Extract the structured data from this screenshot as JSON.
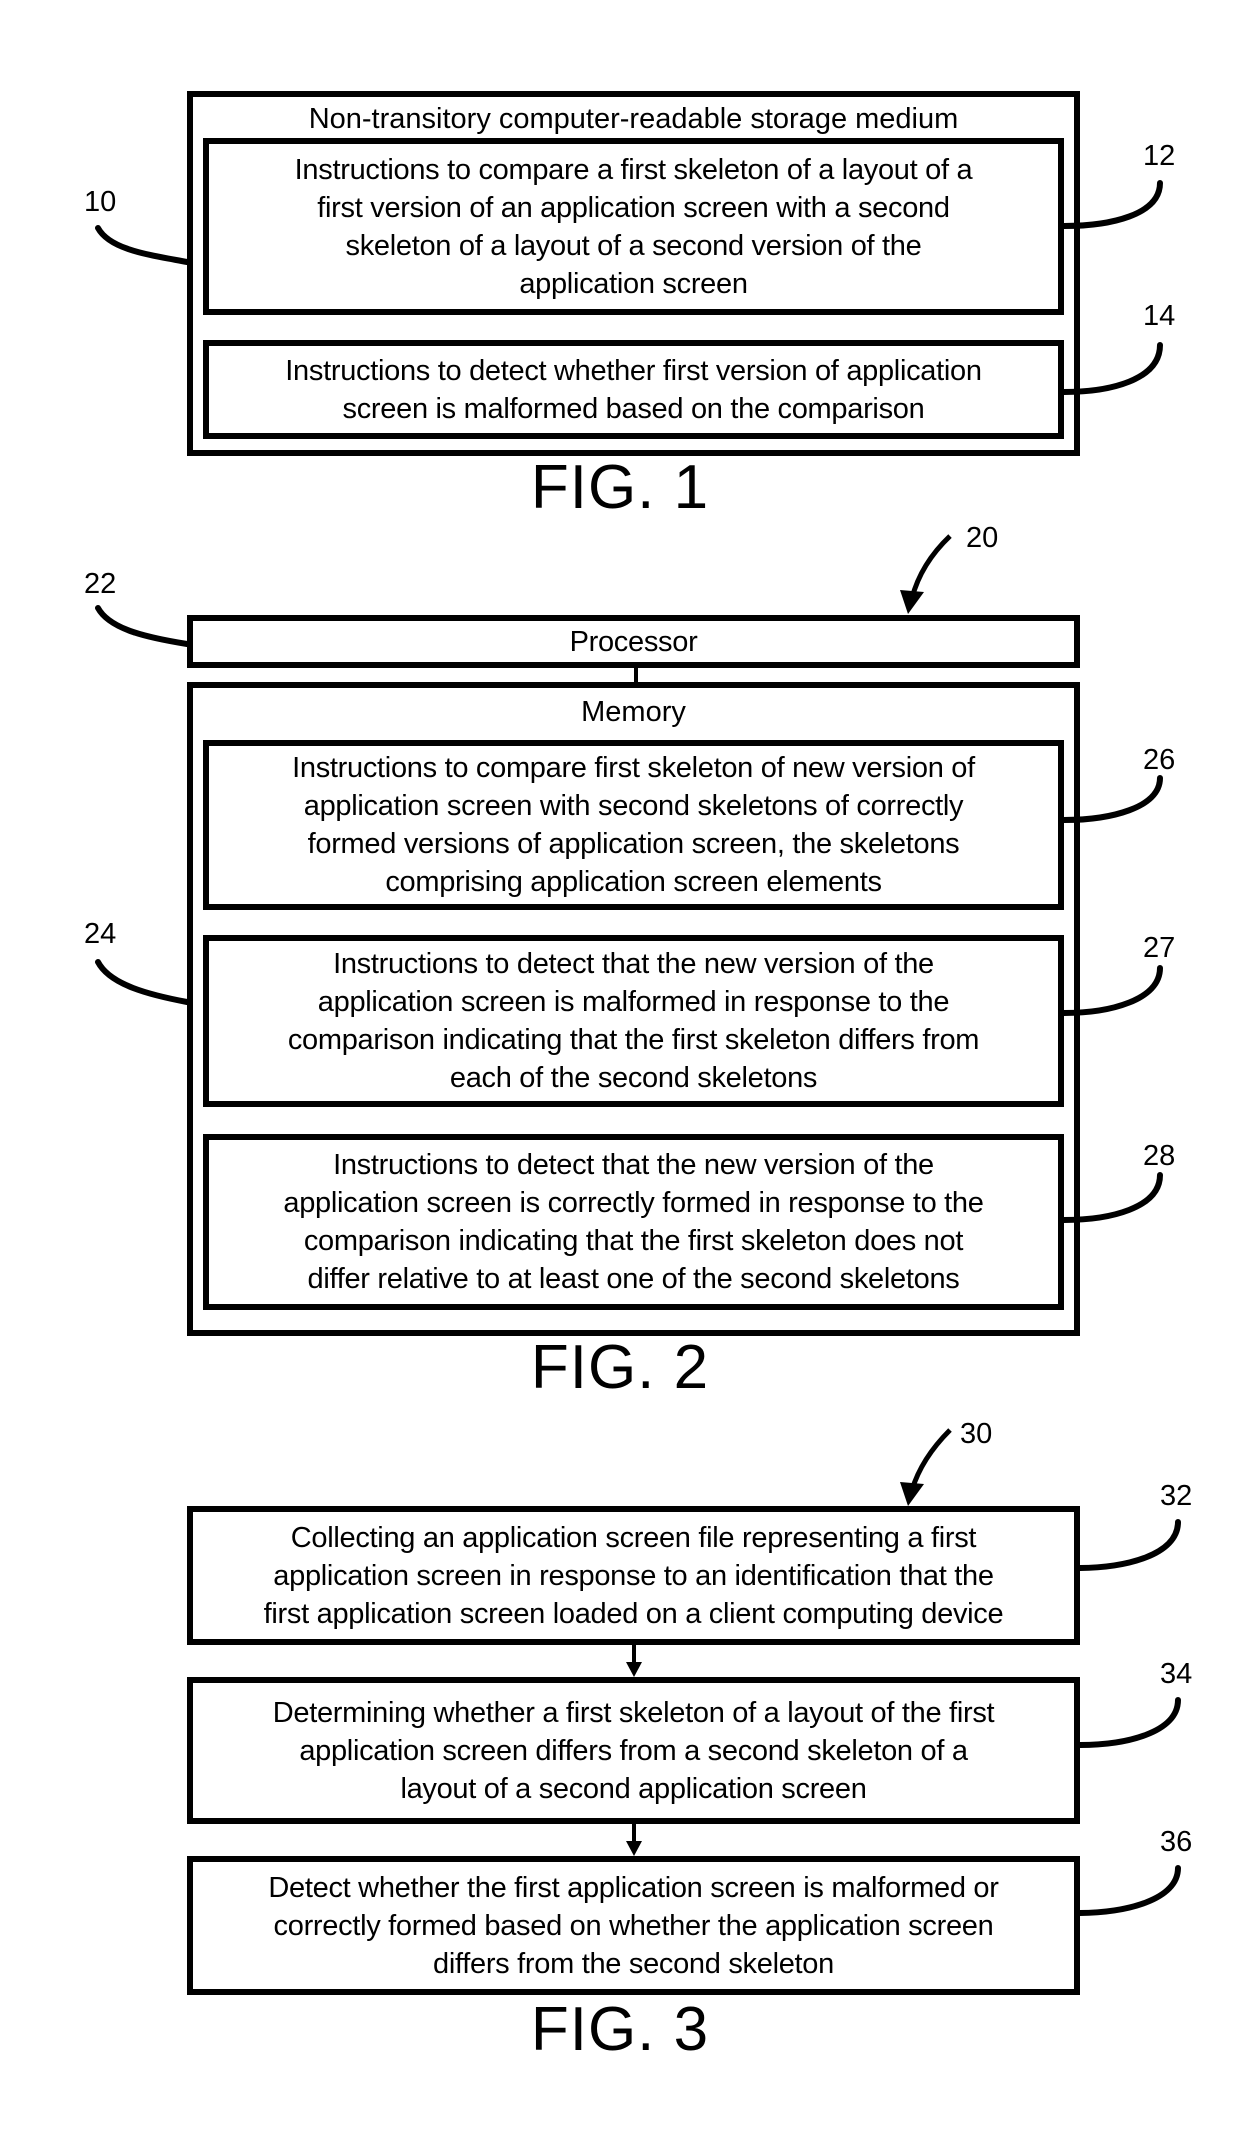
{
  "fig1": {
    "caption": "FIG. 1",
    "ref_main": "10",
    "container_title": "Non-transitory computer-readable storage medium",
    "blocks": [
      {
        "ref": "12",
        "text": "Instructions to compare a first skeleton of a layout of a\nfirst version of an application screen with a second\nskeleton of a layout of a second version of the\napplication screen"
      },
      {
        "ref": "14",
        "text": "Instructions to detect whether first version of application\nscreen is malformed based on the comparison"
      }
    ]
  },
  "fig2": {
    "caption": "FIG. 2",
    "ref_main": "20",
    "processor": {
      "ref": "22",
      "label": "Processor"
    },
    "memory": {
      "ref": "24",
      "label": "Memory",
      "blocks": [
        {
          "ref": "26",
          "text": "Instructions to compare first skeleton of new version of\napplication screen with second skeletons of correctly\nformed versions of application screen, the skeletons\ncomprising application screen elements"
        },
        {
          "ref": "27",
          "text": "Instructions to detect that the new version of the\napplication screen is malformed in response to the\ncomparison indicating that the first skeleton differs from\neach of the second skeletons"
        },
        {
          "ref": "28",
          "text": "Instructions to detect that the new version of the\napplication screen is correctly formed in response to the\ncomparison indicating that the first skeleton does not\ndiffer relative to at least one of the second skeletons"
        }
      ]
    }
  },
  "fig3": {
    "caption": "FIG. 3",
    "ref_main": "30",
    "steps": [
      {
        "ref": "32",
        "text": "Collecting an application screen file representing a first\napplication screen in response to an identification that the\nfirst application screen loaded on a client computing device"
      },
      {
        "ref": "34",
        "text": "Determining whether a first skeleton of a layout of the first\napplication screen differs from a second skeleton of a\nlayout of a second application screen"
      },
      {
        "ref": "36",
        "text": "Detect whether the first application screen is malformed or\ncorrectly formed based on whether the application screen\ndiffers from the second skeleton"
      }
    ]
  }
}
